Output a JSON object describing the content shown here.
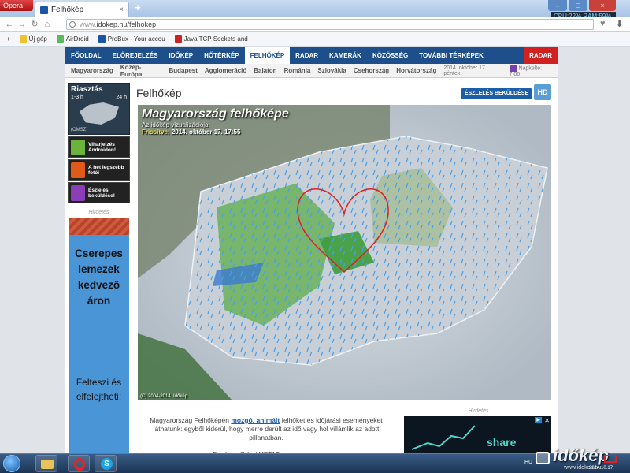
{
  "browser": {
    "menu_label": "Opera",
    "tab_title": "Felhőkép",
    "tab_close": "×",
    "new_tab": "+",
    "url_scheme": "www.",
    "url_rest": "idokep.hu/felhokep",
    "sysmon": "CPU:22%  RAM:59%",
    "bookmarks": [
      {
        "label": "Új gép",
        "color": "#f0c030"
      },
      {
        "label": "AirDroid",
        "color": "#5cb85c"
      },
      {
        "label": "ProBux - Your accou",
        "color": "#1a56a8"
      },
      {
        "label": "Java TCP Sockets and",
        "color": "#c22"
      }
    ]
  },
  "nav": {
    "items": [
      "FŐOLDAL",
      "ELŐREJELZÉS",
      "IDŐKÉP",
      "HŐTÉRKÉP",
      "FELHŐKÉP",
      "RADAR",
      "KAMERÁK",
      "KÖZÖSSÉG",
      "TOVÁBBI TÉRKÉPEK"
    ],
    "active_index": 4,
    "radar": "RADAR"
  },
  "subnav": {
    "regions": [
      "Magyarország",
      "Közép-Európa",
      "Budapest",
      "Agglomeráció",
      "Balaton",
      "Románia",
      "Szlovákia",
      "Csehország",
      "Horvátország"
    ],
    "date": "2014. október 17. péntek",
    "sunset": "Napkelte: 7:06"
  },
  "sidebar": {
    "forecast_title": "Riasztás",
    "forecast_left": "1-3 h",
    "forecast_right": "24 h",
    "omsz": "(OMSZ)",
    "boxes": [
      {
        "label": "Viharjelzés Androidon!",
        "color": "#6cb33e"
      },
      {
        "label": "A hét legszebb fotói",
        "color": "#e05a1a"
      },
      {
        "label": "Észlelés beküldése!",
        "color": "#8a3fb8"
      }
    ],
    "ad_label": "Hirdetés",
    "ad_text": "Cserepes lemezek kedvező áron",
    "ad_text2": "Felteszi és elfelejtheti!"
  },
  "main": {
    "title": "Felhőkép",
    "report_button": "ÉSZLELÉS BEKÜLDÉSE",
    "hd_button": "HD",
    "map_title": "Magyarország felhőképe",
    "map_subtitle": "Az időkép vizualizációja",
    "map_time_key": "Frissítve:",
    "map_time_value": "2014. október 17. 17:55",
    "map_copy": "(C) 2004-2014. Időkép",
    "desc_pre": "Magyarország Felhőképén ",
    "desc_link": "mozgó, animált",
    "desc_post": " felhőket és időjárási eseményeket láthatunk: egyből kiderül, hogy merre derült az idő vagy hol villámlik az adott pillanatban.",
    "desc2": "Forrás: Időkép / METAS",
    "ad2_label": "Hirdetés",
    "ad2_text": "share"
  },
  "taskbar": {
    "tray_lang": "HU",
    "time": "2014.10.17.",
    "watermark": "időkép",
    "watermark_small": "www.idokep.hu"
  }
}
